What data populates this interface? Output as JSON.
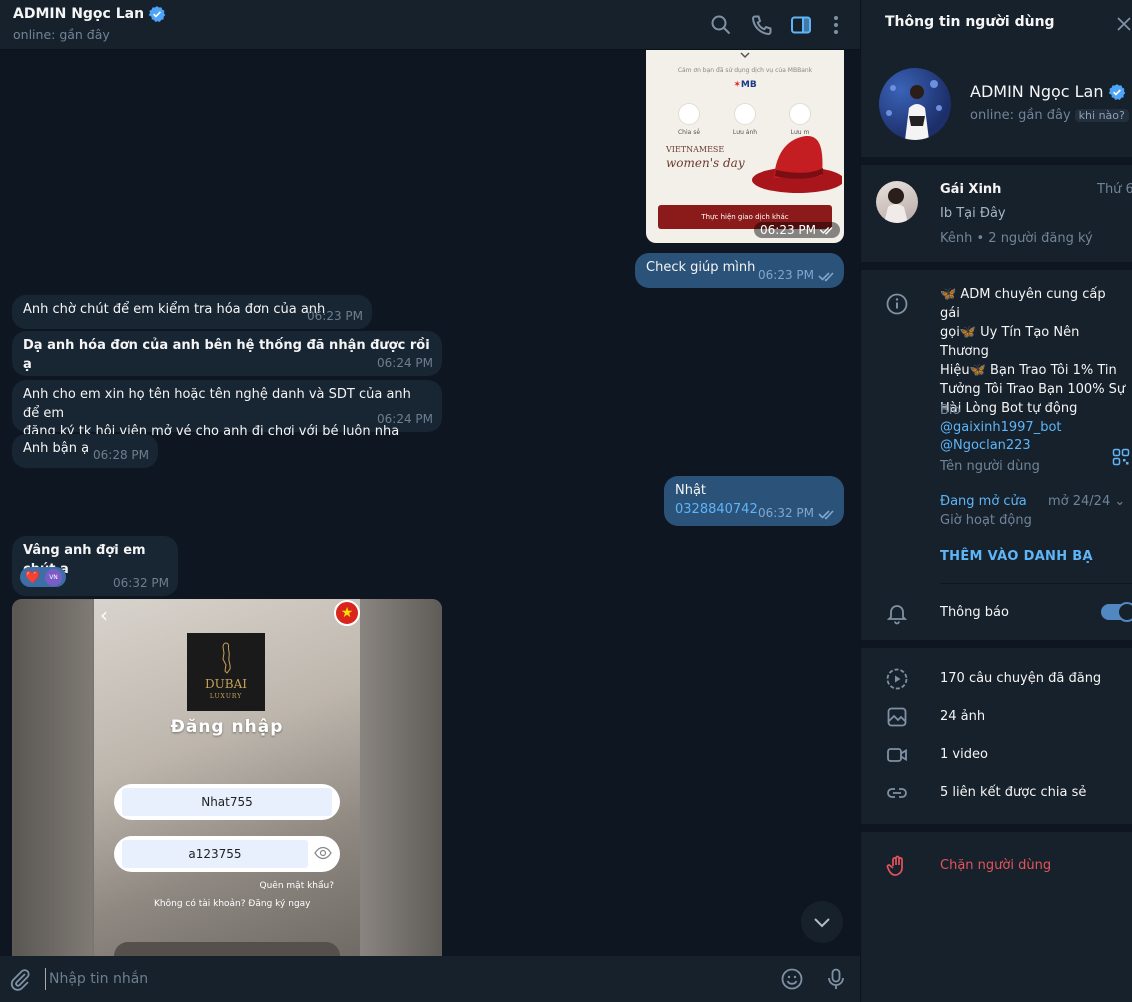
{
  "header": {
    "title": "ADMIN Ngọc Lan",
    "status": "online: gần đây"
  },
  "messages": {
    "receipt_image": {
      "thanks_text": "Cảm ơn bạn đã sử dụng dịch vụ của MBBank",
      "logo": "MB",
      "actions": [
        "Chia sẻ",
        "Lưu ảnh",
        "Lưu m"
      ],
      "promo_line1": "VIETNAMESE",
      "promo_line2": "women's day",
      "button": "Thực hiện giao dịch khác",
      "time": "06:23 PM"
    },
    "out1": {
      "text": "Check giúp mình",
      "time": "06:23 PM"
    },
    "in1": {
      "text": "Anh chờ chút để em kiểm tra hóa đơn của anh",
      "time": "06:23 PM"
    },
    "in2": {
      "text": "Dạ anh hóa đơn của anh bên hệ thống đã nhận được rồi ạ",
      "time": "06:24 PM"
    },
    "in3": {
      "line1": "Anh cho em xin họ tên hoặc tên nghệ danh và SDT  của anh để em",
      "line2": "đăng ký tk hội viên mở vé cho anh đi chơi với bé luôn nha",
      "time": "06:24 PM"
    },
    "in4": {
      "text": "Anh bận ạ",
      "time": "06:28 PM"
    },
    "out2": {
      "line1": "Nhật",
      "phone": "0328840742",
      "time": "06:32 PM"
    },
    "in5": {
      "text": "Vâng anh đợi em chút ạ",
      "reaction": "❤️",
      "reactor": "VN",
      "time": "06:32 PM"
    },
    "login_image": {
      "logo_word": "DUBAI",
      "logo_sub": "LUXURY",
      "heading": "Đăng nhập",
      "username": "Nhat755",
      "password": "a123755",
      "forgot": "Quên mật khẩu?",
      "register": "Không có tài khoản?  Đăng ký ngay",
      "flag_star": "★"
    }
  },
  "composer": {
    "placeholder": "Nhập tin nhắn"
  },
  "panel": {
    "title": "Thông tin người dùng",
    "name": "ADMIN Ngọc Lan",
    "status": "online: gần đây",
    "when_badge": "khi nào?",
    "channel": {
      "name": "Gái Xinh",
      "date": "Thứ 6",
      "desc": "Ib Tại Đây",
      "subs": "Kênh • 2 người đăng ký"
    },
    "bio": {
      "line1": "🦋 ADM chuyên cung cấp gái",
      "line2": "gọi🦋 Uy Tín Tạo Nên Thương",
      "line3": "Hiệu🦋 Bạn Trao Tôi 1% Tin",
      "line4": "Tưởng Tôi Trao Bạn 100% Sự",
      "line5": "Hài Lòng Bot tự động",
      "link": "@gaixinh1997_bot",
      "label": "Bio"
    },
    "username": {
      "value": "@Ngoclan223",
      "label": "Tên người dùng"
    },
    "hours": {
      "value": "Đang mở cửa",
      "right": "mở 24/24",
      "label": "Giờ hoạt động"
    },
    "add_contact": "THÊM VÀO DANH BẠ",
    "notifications": {
      "label": "Thông báo",
      "enabled": true
    },
    "media": {
      "stories": "170 câu chuyện đã đăng",
      "photos": "24 ảnh",
      "videos": "1 video",
      "links": "5 liên kết được chia sẻ"
    },
    "block": "Chặn người dùng"
  },
  "colors": {
    "accent": "#5eb5f7",
    "out_bubble": "#2b5278",
    "in_bubble": "#182533",
    "danger": "#e5535b"
  }
}
